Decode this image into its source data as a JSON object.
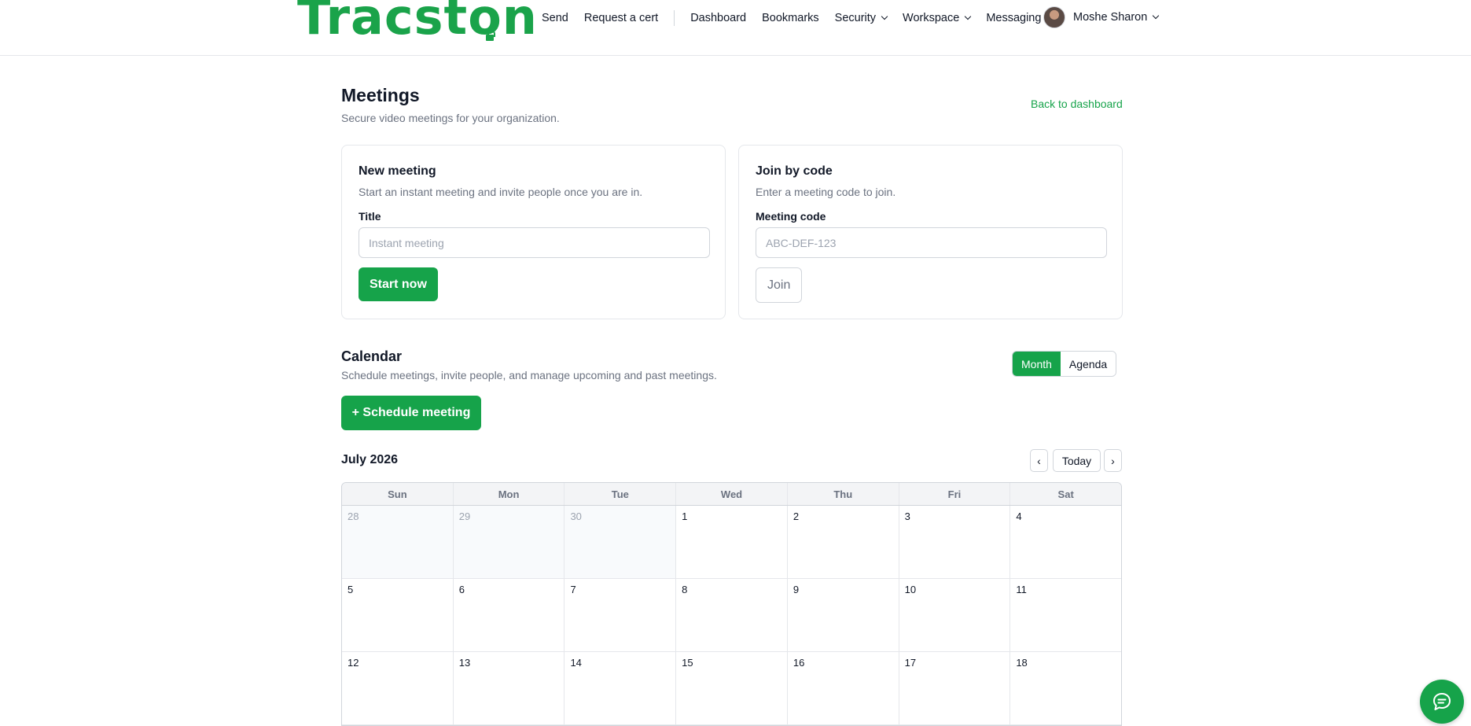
{
  "brand": {
    "name": "Tracston"
  },
  "nav": {
    "items": [
      "Send",
      "Request a cert"
    ],
    "items2": [
      "Dashboard",
      "Bookmarks"
    ],
    "dropdowns": [
      "Security",
      "Workspace",
      "Messaging"
    ],
    "user_name": "Moshe Sharon"
  },
  "page": {
    "title": "Meetings",
    "subtitle": "Secure video meetings for your organization.",
    "back_link": "Back to dashboard"
  },
  "new_meeting": {
    "title": "New meeting",
    "description": "Start an instant meeting and invite people once you are in.",
    "field_label": "Title",
    "placeholder": "Instant meeting",
    "button": "Start now"
  },
  "join": {
    "title": "Join by code",
    "description": "Enter a meeting code to join.",
    "field_label": "Meeting code",
    "placeholder": "ABC-DEF-123",
    "button": "Join"
  },
  "calendar": {
    "title": "Calendar",
    "subtitle": "Schedule meetings, invite people, and manage upcoming and past meetings.",
    "view_month": "Month",
    "view_agenda": "Agenda",
    "schedule_button": "+ Schedule meeting",
    "month_label": "July 2026",
    "prev": "‹",
    "today": "Today",
    "next": "›",
    "weekdays": [
      "Sun",
      "Mon",
      "Tue",
      "Wed",
      "Thu",
      "Fri",
      "Sat"
    ],
    "weeks": [
      [
        "28",
        "29",
        "30",
        "1",
        "2",
        "3",
        "4"
      ],
      [
        "5",
        "6",
        "7",
        "8",
        "9",
        "10",
        "11"
      ],
      [
        "12",
        "13",
        "14",
        "15",
        "16",
        "17",
        "18"
      ]
    ],
    "muted_days": [
      "28",
      "29",
      "30"
    ]
  },
  "colors": {
    "accent": "#16a34a",
    "muted_bg": "#f8fafc"
  },
  "icons": {
    "chat": "chat-bubble-icon",
    "dropdown": "chevron-down-icon"
  }
}
